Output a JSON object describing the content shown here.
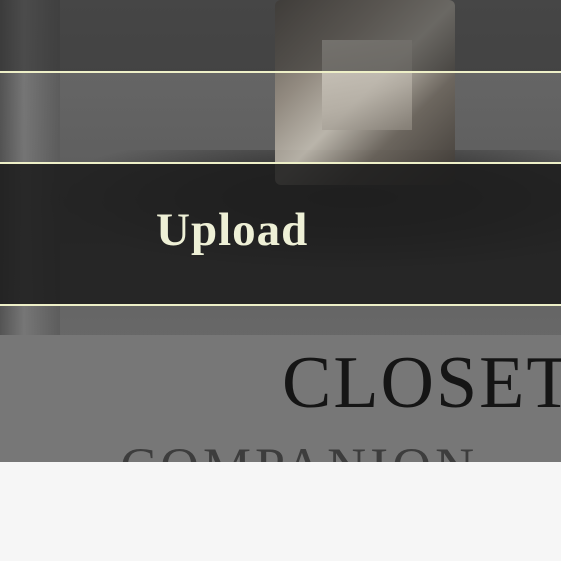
{
  "upload": {
    "label": "Upload"
  },
  "background_image": {
    "book_title": "CLOSET",
    "book_subtitle": "COMPANION"
  },
  "colors": {
    "accent_line": "#eef0c8",
    "label_text": "#eef0d6",
    "panel_bg": "#f6f6f6"
  }
}
